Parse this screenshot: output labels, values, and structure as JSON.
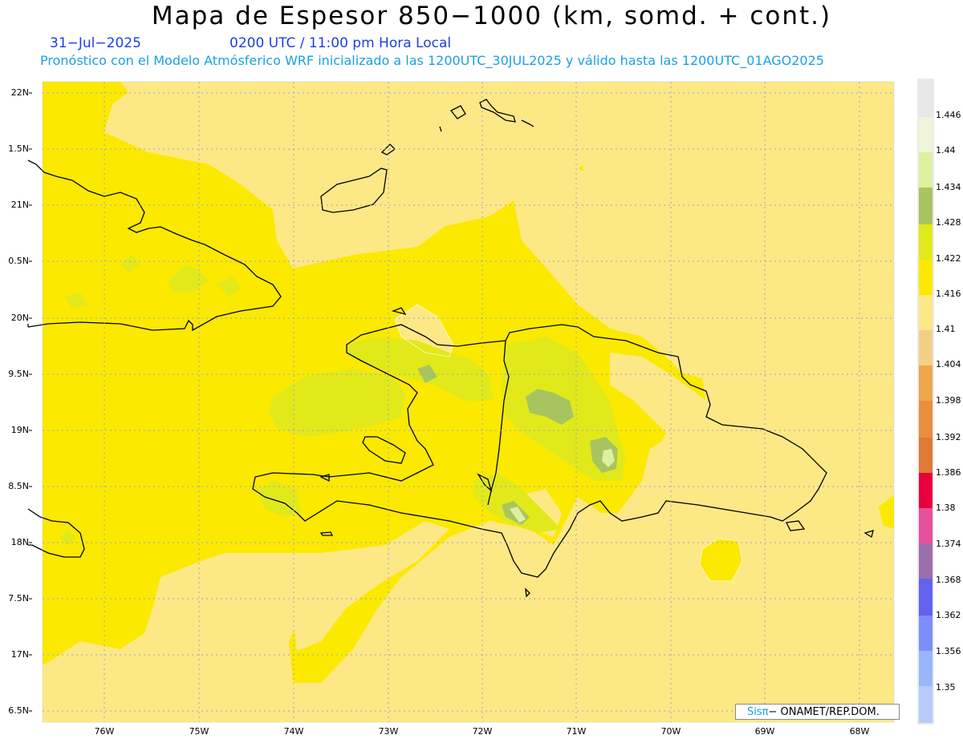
{
  "header": {
    "title": "Mapa de Espesor 850−1000 (km, somd. + cont.)",
    "date": "31−Jul−2025",
    "time": "0200 UTC / 11:00 pm Hora Local",
    "model_info": "Pronóstico con el Modelo Atmósferico WRF inicializado a las 1200UTC_30JUL2025 y válido hasta las  1200UTC_01AGO2025"
  },
  "map": {
    "lat_labels": [
      "22N",
      "1.5N",
      "21N",
      "0.5N",
      "20N",
      "9.5N",
      "19N",
      "8.5N",
      "18N",
      "7.5N",
      "17N",
      "6.5N"
    ],
    "lon_labels": [
      "76W",
      "75W",
      "74W",
      "73W",
      "72W",
      "71W",
      "70W",
      "69W",
      "68W"
    ],
    "background_color": "#fde886",
    "colors": {
      "level_1410": "#fde886",
      "level_1416": "#fbe900",
      "level_1422": "#e2e91a",
      "level_1428": "#a7c55f",
      "level_1434": "#ddf0a0",
      "level_1440": "#eef5d8"
    }
  },
  "colorbar": {
    "levels": [
      "1.446",
      "1.44",
      "1.434",
      "1.428",
      "1.422",
      "1.416",
      "1.41",
      "1.404",
      "1.398",
      "1.392",
      "1.386",
      "1.38",
      "1.374",
      "1.368",
      "1.362",
      "1.356",
      "1.35"
    ],
    "colors": [
      "#e8e8e8",
      "#eef5d8",
      "#ddf0a0",
      "#a7c55f",
      "#e2e91a",
      "#fbe900",
      "#fde886",
      "#f3cf86",
      "#eea74b",
      "#e98e3c",
      "#de7a36",
      "#e8003c",
      "#e6509c",
      "#9a6ea8",
      "#6262f0",
      "#7e8ef8",
      "#98b6fb",
      "#b8cbfb"
    ]
  },
  "credit": {
    "brand": "Sisπ",
    "org": "− ONAMET/REP.DOM."
  }
}
